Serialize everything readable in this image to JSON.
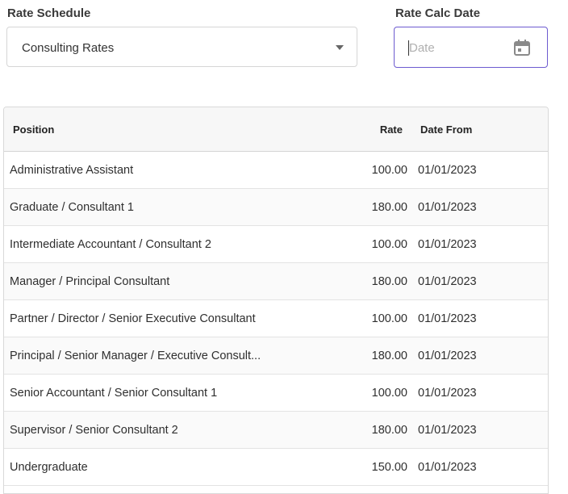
{
  "form": {
    "rate_schedule_label": "Rate Schedule",
    "rate_schedule_value": "Consulting Rates",
    "rate_calc_date_label": "Rate Calc Date",
    "date_placeholder": "Date"
  },
  "icons": {
    "dropdown": "chevron-down-icon",
    "calendar": "calendar-icon"
  },
  "colors": {
    "focus_border": "#6d5bd0"
  },
  "table": {
    "headers": {
      "position": "Position",
      "rate": "Rate",
      "date_from": "Date From"
    },
    "rows": [
      {
        "position": "Administrative Assistant",
        "rate": "100.00",
        "date_from": "01/01/2023"
      },
      {
        "position": "Graduate / Consultant 1",
        "rate": "180.00",
        "date_from": "01/01/2023"
      },
      {
        "position": "Intermediate Accountant / Consultant 2",
        "rate": "100.00",
        "date_from": "01/01/2023"
      },
      {
        "position": "Manager / Principal Consultant",
        "rate": "180.00",
        "date_from": "01/01/2023"
      },
      {
        "position": "Partner / Director / Senior Executive Consultant",
        "rate": "100.00",
        "date_from": "01/01/2023"
      },
      {
        "position": "Principal / Senior Manager / Executive Consult...",
        "rate": "180.00",
        "date_from": "01/01/2023"
      },
      {
        "position": "Senior Accountant / Senior Consultant 1",
        "rate": "100.00",
        "date_from": "01/01/2023"
      },
      {
        "position": "Supervisor / Senior Consultant 2",
        "rate": "180.00",
        "date_from": "01/01/2023"
      },
      {
        "position": "Undergraduate",
        "rate": "150.00",
        "date_from": "01/01/2023"
      }
    ]
  }
}
